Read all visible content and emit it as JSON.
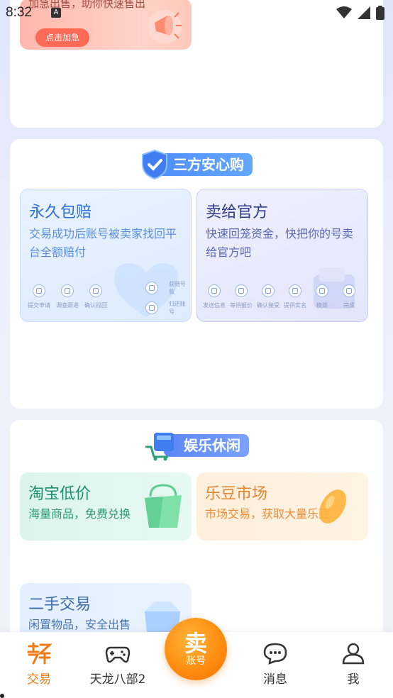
{
  "status_bar": {
    "time": "8:32",
    "notification_letter": "A"
  },
  "promo": {
    "text": "加急出售，助你快速售出",
    "button_label": "点击加急"
  },
  "security_section": {
    "badge_label": "三方安心购",
    "yongjiu": {
      "title": "永久包赔",
      "subtitle": "交易成功后账号被卖家找回平台全额赔付",
      "steps": [
        "提交申请",
        "调查跟进",
        "确认找回"
      ],
      "steps_branch": [
        "获赔号款",
        "归还账号"
      ]
    },
    "maigei": {
      "title": "卖给官方",
      "subtitle": "快速回笼资金，快把你的号卖给官方吧",
      "steps": [
        "发送信息",
        "等待报价",
        "确认接受",
        "提供实名",
        "换绑",
        "完成"
      ]
    }
  },
  "entertainment_section": {
    "badge_label": "娱乐休闲",
    "taobao": {
      "title": "淘宝低价",
      "subtitle": "海量商品，免费兑换"
    },
    "ledou": {
      "title": "乐豆市场",
      "subtitle": "市场交易，获取大量乐豆"
    },
    "ershou": {
      "title": "二手交易",
      "subtitle": "闲置物品，安全出售"
    }
  },
  "bottom_nav": {
    "items": [
      "交易",
      "天龙八部2",
      "消息",
      "我"
    ],
    "sell_big": "卖",
    "sell_small": "账号"
  },
  "colors": {
    "accent": "#f27a12",
    "blue": "#4d8df7"
  }
}
